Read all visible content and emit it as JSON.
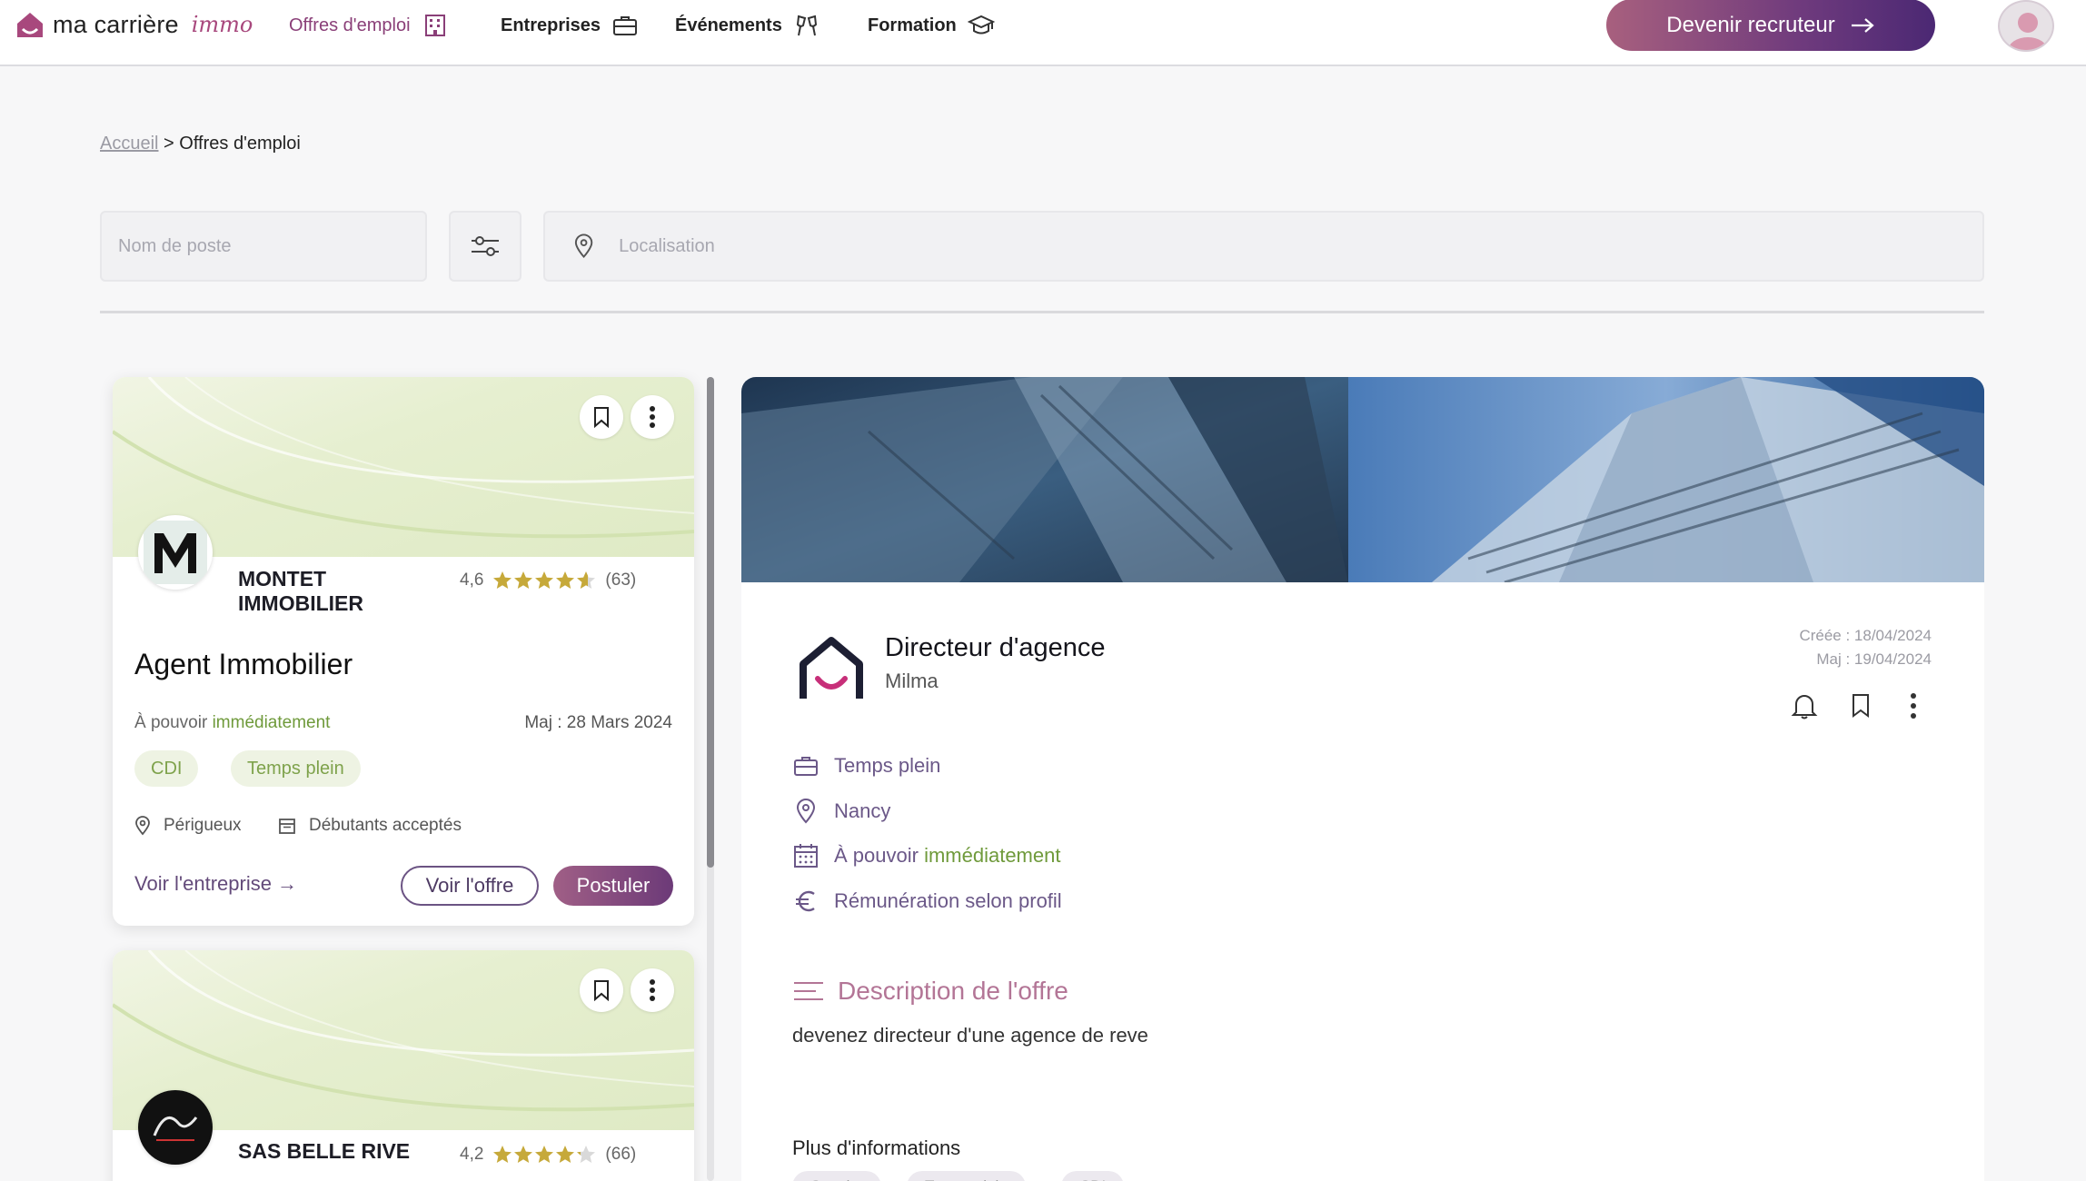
{
  "header": {
    "brand": "ma carrière",
    "brand_accent": "immo",
    "nav": [
      {
        "label": "Offres d'emploi",
        "icon": "building-icon",
        "active": true
      },
      {
        "label": "Entreprises",
        "icon": "briefcase-icon"
      },
      {
        "label": "Événements",
        "icon": "cheers-icon"
      },
      {
        "label": "Formation",
        "icon": "graduation-cap-icon"
      }
    ],
    "cta_label": "Devenir recruteur",
    "cta_icon": "arrow-right-icon",
    "avatar_icon": "user-icon"
  },
  "breadcrumb": {
    "home": "Accueil",
    "separator": ">",
    "current": "Offres d'emploi"
  },
  "search": {
    "job_placeholder": "Nom de poste",
    "filter_icon": "filter-icon",
    "location_placeholder": "Localisation",
    "location_icon": "map-pin-icon"
  },
  "job_cards": [
    {
      "company": "MONTET IMMOBILIER",
      "rating": "4,6",
      "reviews": "(63)",
      "stars_value": 4.6,
      "title": "Agent Immobilier",
      "availability_prefix": "À pouvoir",
      "availability_value": "immédiatement",
      "updated": "Maj : 28 Mars 2024",
      "tags": [
        "CDI",
        "Temps plein"
      ],
      "location": "Périgueux",
      "experience": "Débutants acceptés",
      "company_link": "Voir l'entreprise →",
      "view_label": "Voir l'offre",
      "apply_label": "Postuler"
    },
    {
      "company": "SAS BELLE RIVE",
      "rating": "4,2",
      "reviews": "(66)",
      "stars_value": 4.2
    }
  ],
  "detail": {
    "title": "Directeur d'agence",
    "company": "Milma",
    "created": "Créée : 18/04/2024",
    "updated": "Maj : 19/04/2024",
    "contract": "Temps plein",
    "location": "Nancy",
    "availability_prefix": "À pouvoir",
    "availability_value": "immédiatement",
    "salary": "Rémunération selon profil",
    "description_title": "Description de l'offre",
    "description": "devenez directeur d'une agence de reve",
    "more_title": "Plus d'informations",
    "more_tags": [
      "Sur site",
      "Temps plein",
      "CDI"
    ]
  },
  "colors": {
    "accent": "#8a3f78",
    "green": "#6f9a3b",
    "star": "#c6a93a"
  }
}
